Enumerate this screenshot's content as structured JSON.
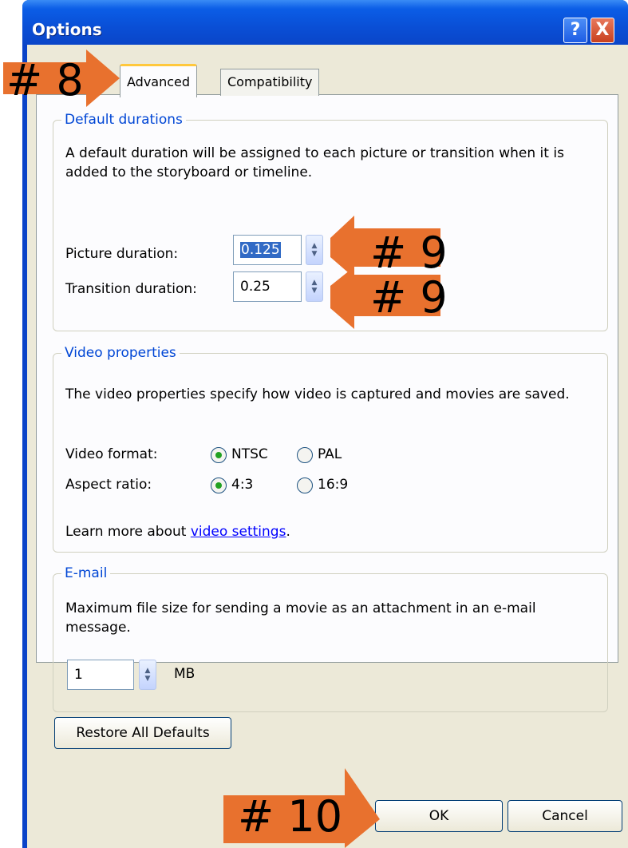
{
  "window": {
    "title": "Options",
    "help_glyph": "?",
    "close_glyph": "X"
  },
  "tabs": [
    {
      "label": "Advanced",
      "selected": true
    },
    {
      "label": "Compatibility",
      "selected": false
    }
  ],
  "default_durations": {
    "legend": "Default durations",
    "description": "A default duration will be assigned to each picture or transition when it is added to the storyboard or timeline.",
    "picture_label": "Picture duration:",
    "picture_value": "0.125",
    "transition_label": "Transition duration:",
    "transition_value": "0.25"
  },
  "video_properties": {
    "legend": "Video properties",
    "description": "The video properties specify how video is captured and movies are saved.",
    "format_label": "Video format:",
    "format_options": [
      "NTSC",
      "PAL"
    ],
    "format_selected": "NTSC",
    "aspect_label": "Aspect ratio:",
    "aspect_options": [
      "4:3",
      "16:9"
    ],
    "aspect_selected": "4:3",
    "learn_more_prefix": "Learn more about ",
    "learn_more_link": "video settings",
    "learn_more_suffix": "."
  },
  "email": {
    "legend": "E-mail",
    "description": "Maximum file size for sending a movie as an attachment in an e-mail message.",
    "size_value": "1",
    "unit": "MB"
  },
  "buttons": {
    "restore_defaults": "Restore All Defaults",
    "ok": "OK",
    "cancel": "Cancel"
  },
  "annotations": {
    "tab_marker": "# 8",
    "spinner_marker_1": "# 9",
    "spinner_marker_2": "# 9",
    "ok_marker": "# 10"
  },
  "colors": {
    "titlebar": "#0a4fd6",
    "annotation_arrow": "#e8712e",
    "legend_text": "#0046d5",
    "link": "#0000ff"
  }
}
